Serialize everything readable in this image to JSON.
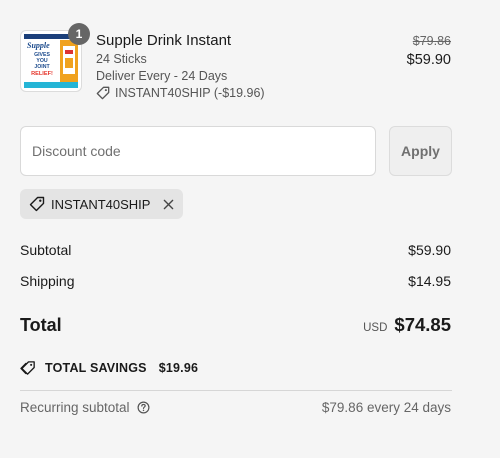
{
  "product": {
    "quantity": "1",
    "name": "Supple Drink Instant",
    "variant": "24 Sticks",
    "delivery": "Deliver Every - 24 Days",
    "discount_tag": "INSTANT40SHIP (-$19.96)",
    "original_price": "$79.86",
    "price": "$59.90",
    "thumbnail": {
      "brand": "Supple",
      "line1": "GIVES",
      "line2": "YOU",
      "line3": "JOINT",
      "line4": "RELIEF!",
      "accent_color": "#f0a21e",
      "text_color": "#1b4a8c"
    }
  },
  "discount": {
    "placeholder": "Discount code",
    "apply_label": "Apply",
    "applied_code": "INSTANT40SHIP"
  },
  "summary": {
    "subtotal_label": "Subtotal",
    "subtotal_value": "$59.90",
    "shipping_label": "Shipping",
    "shipping_value": "$14.95",
    "total_label": "Total",
    "currency": "USD",
    "total_value": "$74.85",
    "savings_label": "TOTAL SAVINGS",
    "savings_value": "$19.96",
    "recurring_label": "Recurring subtotal",
    "recurring_value": "$79.86 every 24 days"
  },
  "icons": {
    "tag": "tag-icon",
    "close": "close-icon",
    "savings": "savings-tags-icon",
    "help": "help-circle-icon"
  }
}
